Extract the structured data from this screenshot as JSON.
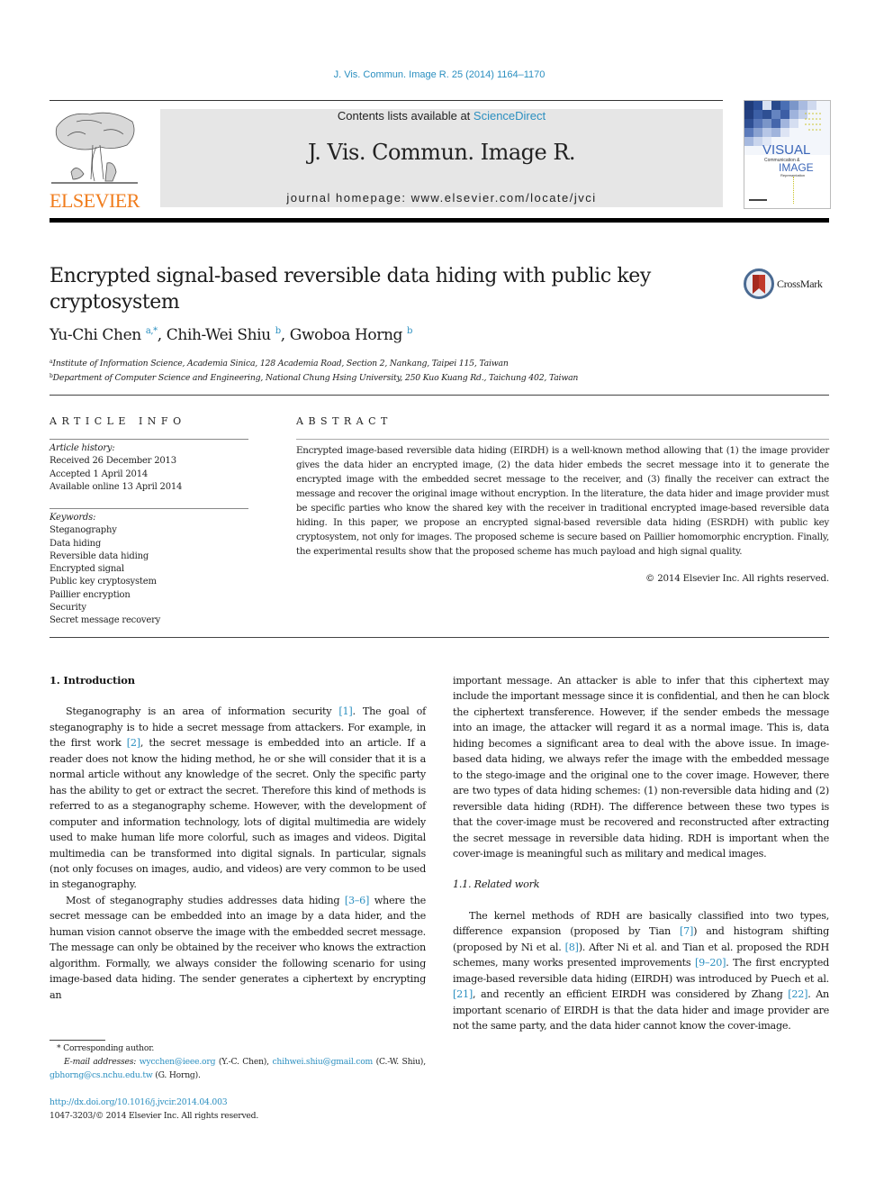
{
  "header": {
    "journal_ref": "J. Vis. Commun. Image R. 25 (2014) 1164–1170",
    "contents_prefix": "Contents lists available at ",
    "contents_link": "ScienceDirect",
    "journal_title": "J. Vis. Commun. Image R.",
    "homepage_prefix": "journal homepage: ",
    "homepage_url": "www.elsevier.com/locate/jvci",
    "publisher_logo": "ELSEVIER",
    "cover": {
      "word1": "VISUAL",
      "word2": "Communication &",
      "word3": "IMAGE",
      "word4": "Representation"
    }
  },
  "crossmark_label": "CrossMark",
  "article": {
    "title": "Encrypted signal-based reversible data hiding with public key cryptosystem",
    "authors": [
      {
        "name": "Yu-Chi Chen",
        "sup": "a,*"
      },
      {
        "name": "Chih-Wei Shiu",
        "sup": "b"
      },
      {
        "name": "Gwoboa Horng",
        "sup": "b"
      }
    ],
    "separator": ", ",
    "affiliations": [
      {
        "sup": "a",
        "text": "Institute of Information Science, Academia Sinica, 128 Academia Road, Section 2, Nankang, Taipei 115, Taiwan"
      },
      {
        "sup": "b",
        "text": "Department of Computer Science and Engineering, National Chung Hsing University, 250 Kuo Kuang Rd., Taichung 402, Taiwan"
      }
    ]
  },
  "article_info": {
    "heading": "ARTICLE INFO",
    "history_label": "Article history:",
    "history": [
      "Received 26 December 2013",
      "Accepted 1 April 2014",
      "Available online 13 April 2014"
    ],
    "keywords_label": "Keywords:",
    "keywords": [
      "Steganography",
      "Data hiding",
      "Reversible data hiding",
      "Encrypted signal",
      "Public key cryptosystem",
      "Paillier encryption",
      "Security",
      "Secret message recovery"
    ]
  },
  "abstract": {
    "heading": "ABSTRACT",
    "text": "Encrypted image-based reversible data hiding (EIRDH) is a well-known method allowing that (1) the image provider gives the data hider an encrypted image, (2) the data hider embeds the secret message into it to generate the encrypted image with the embedded secret message to the receiver, and (3) finally the receiver can extract the message and recover the original image without encryption. In the literature, the data hider and image provider must be specific parties who know the shared key with the receiver in traditional encrypted image-based reversible data hiding. In this paper, we propose an encrypted signal-based reversible data hiding (ESRDH) with public key cryptosystem, not only for images. The proposed scheme is secure based on Paillier homomorphic encryption. Finally, the experimental results show that the proposed scheme has much payload and high signal quality.",
    "copyright": "© 2014 Elsevier Inc. All rights reserved."
  },
  "body": {
    "section1_heading": "1. Introduction",
    "p1": [
      {
        "t": "Steganography is an area of information security "
      },
      {
        "ref": "[1]"
      },
      {
        "t": ". The goal of steganography is to hide a secret message from attackers. For example, in the first work "
      },
      {
        "ref": "[2]"
      },
      {
        "t": ", the secret message is embedded into an article. If a reader does not know the hiding method, he or she will consider that it is a normal article without any knowledge of the secret. Only the specific party has the ability to get or extract the secret. Therefore this kind of methods is referred to as a steganography scheme. However, with the development of computer and information technology, lots of digital multimedia are widely used to make human life more colorful, such as images and videos. Digital multimedia can be transformed into digital signals. In particular, signals (not only focuses on images, audio, and videos) are very common to be used in steganography."
      }
    ],
    "p2": [
      {
        "t": "Most of steganography studies addresses data hiding "
      },
      {
        "ref": "[3–6]"
      },
      {
        "t": " where the secret message can be embedded into an image by a data hider, and the human vision cannot observe the image with the embedded secret message. The message can only be obtained by the receiver who knows the extraction algorithm. Formally, we always consider the following scenario for using image-based data hiding. The sender generates a ciphertext by encrypting an important message. An attacker is able to infer that this ciphertext may include the important message since it is confidential, and then he can block the ciphertext transference. However, if the sender embeds the message into an image, the attacker will regard it as a normal image. This is, data hiding becomes a significant area to deal with the above issue. In image-based data hiding, we always refer the image with the embedded message to the stego-image and the original one to the cover image. However, there are two types of data hiding schemes: (1) non-reversible data hiding and (2) reversible data hiding (RDH). The difference between these two types is that the cover-image must be recovered and reconstructed after extracting the secret message in reversible data hiding. RDH is important when the cover-image is meaningful such as military and medical images."
      }
    ],
    "p2_left": "Most of steganography studies addresses data hiding ",
    "p2_ref": "[3–6]",
    "p2_left_rest": " where the secret message can be embedded into an image by a data hider, and the human vision cannot observe the image with the embedded secret message. The message can only be obtained by the receiver who knows the extraction algorithm. Formally, we always consider the following scenario for using image-based data hiding. The sender generates a ciphertext by encrypting an",
    "p2_right": "important message. An attacker is able to infer that this ciphertext may include the important message since it is confidential, and then he can block the ciphertext transference. However, if the sender embeds the message into an image, the attacker will regard it as a normal image. This is, data hiding becomes a significant area to deal with the above issue. In image-based data hiding, we always refer the image with the embedded message to the stego-image and the original one to the cover image. However, there are two types of data hiding schemes: (1) non-reversible data hiding and (2) reversible data hiding (RDH). The difference between these two types is that the cover-image must be recovered and reconstructed after extracting the secret message in reversible data hiding. RDH is important when the cover-image is meaningful such as military and medical images.",
    "subsection_heading": "1.1. Related work",
    "p3": [
      {
        "t": "The kernel methods of RDH are basically classified into two types, difference expansion (proposed by Tian "
      },
      {
        "ref": "[7]"
      },
      {
        "t": ") and histogram shifting (proposed by Ni et al. "
      },
      {
        "ref": "[8]"
      },
      {
        "t": "). After Ni et al. and Tian et al. proposed the RDH schemes, many works presented improvements "
      },
      {
        "ref": "[9–20]"
      },
      {
        "t": ". The first encrypted image-based reversible data hiding (EIRDH) was introduced by Puech et al. "
      },
      {
        "ref": "[21]"
      },
      {
        "t": ", and recently an efficient EIRDH was considered by Zhang "
      },
      {
        "ref": "[22]"
      },
      {
        "t": ". An important scenario of EIRDH is that the data hider and image provider are not the same party, and the data hider cannot know the cover-image."
      }
    ]
  },
  "footnotes": {
    "corresponding": "* Corresponding author.",
    "email_label": "E-mail addresses:",
    "emails": [
      {
        "addr": "wycchen@ieee.org",
        "who": "(Y.-C. Chen)"
      },
      {
        "addr": "chihwei.shiu@gmail.com",
        "who": "(C.-W. Shiu)"
      },
      {
        "addr": "gbhorng@cs.nchu.edu.tw",
        "who": "(G. Horng)."
      }
    ],
    "doi": "http://dx.doi.org/10.1016/j.jvcir.2014.04.003",
    "issn_line": "1047-3203/© 2014 Elsevier Inc. All rights reserved."
  },
  "colors": {
    "link": "#2b8fc0",
    "elsevier_orange": "#f07c1c",
    "masthead_bg": "#e6e6e6",
    "crossmark_red": "#c0392b"
  }
}
